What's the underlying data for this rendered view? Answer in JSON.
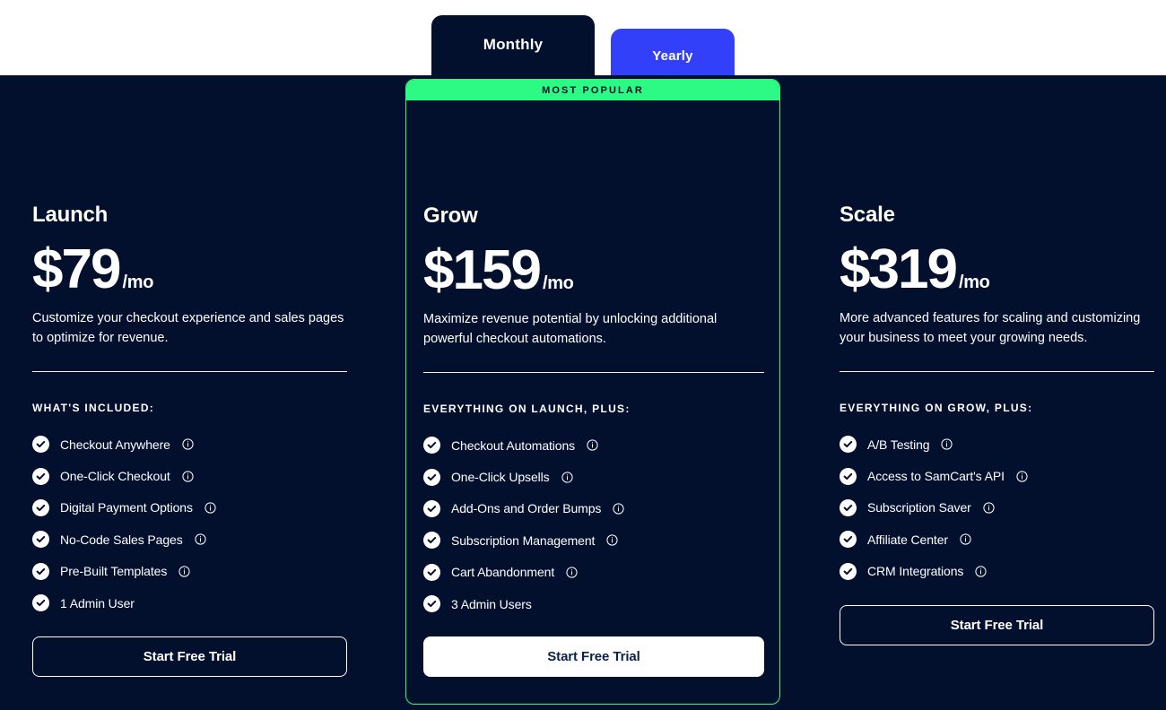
{
  "billing_toggle": {
    "monthly_label": "Monthly",
    "yearly_label": "Yearly",
    "active": "Monthly",
    "monthly_color": "#02102E",
    "yearly_color": "#3340FA"
  },
  "theme": {
    "background": "#02102E",
    "accent_green": "#2DFA85",
    "accent_blue": "#3340FA",
    "text": "#ffffff"
  },
  "plans": [
    {
      "name": "Launch",
      "price": "$79",
      "period": "/mo",
      "description": "Customize your checkout experience and sales pages to optimize for revenue.",
      "included_label": "WHAT'S INCLUDED:",
      "features": [
        {
          "label": "Checkout Anywhere",
          "info": true
        },
        {
          "label": "One-Click Checkout",
          "info": true
        },
        {
          "label": "Digital Payment Options",
          "info": true
        },
        {
          "label": "No-Code Sales Pages",
          "info": true
        },
        {
          "label": "Pre-Built Templates",
          "info": true
        },
        {
          "label": "1 Admin User",
          "info": false
        }
      ],
      "cta_label": "Start Free Trial",
      "cta_style": "outline",
      "badge": null
    },
    {
      "name": "Grow",
      "price": "$159",
      "period": "/mo",
      "description": "Maximize revenue potential by unlocking additional powerful checkout automations.",
      "included_label": "EVERYTHING ON LAUNCH, PLUS:",
      "features": [
        {
          "label": "Checkout Automations",
          "info": true
        },
        {
          "label": "One-Click Upsells",
          "info": true
        },
        {
          "label": "Add-Ons and Order Bumps",
          "info": true
        },
        {
          "label": "Subscription Management",
          "info": true
        },
        {
          "label": "Cart Abandonment",
          "info": true
        },
        {
          "label": "3 Admin Users",
          "info": false
        }
      ],
      "cta_label": "Start Free Trial",
      "cta_style": "solid",
      "badge": "MOST POPULAR"
    },
    {
      "name": "Scale",
      "price": "$319",
      "period": "/mo",
      "description": "More advanced features for scaling and customizing your business to meet your growing needs.",
      "included_label": "EVERYTHING ON GROW, PLUS:",
      "features": [
        {
          "label": "A/B Testing",
          "info": true
        },
        {
          "label": "Access to SamCart's API",
          "info": true
        },
        {
          "label": "Subscription Saver",
          "info": true
        },
        {
          "label": "Affiliate Center",
          "info": true
        },
        {
          "label": "CRM Integrations",
          "info": true
        }
      ],
      "cta_label": "Start Free Trial",
      "cta_style": "outline",
      "badge": null
    }
  ]
}
